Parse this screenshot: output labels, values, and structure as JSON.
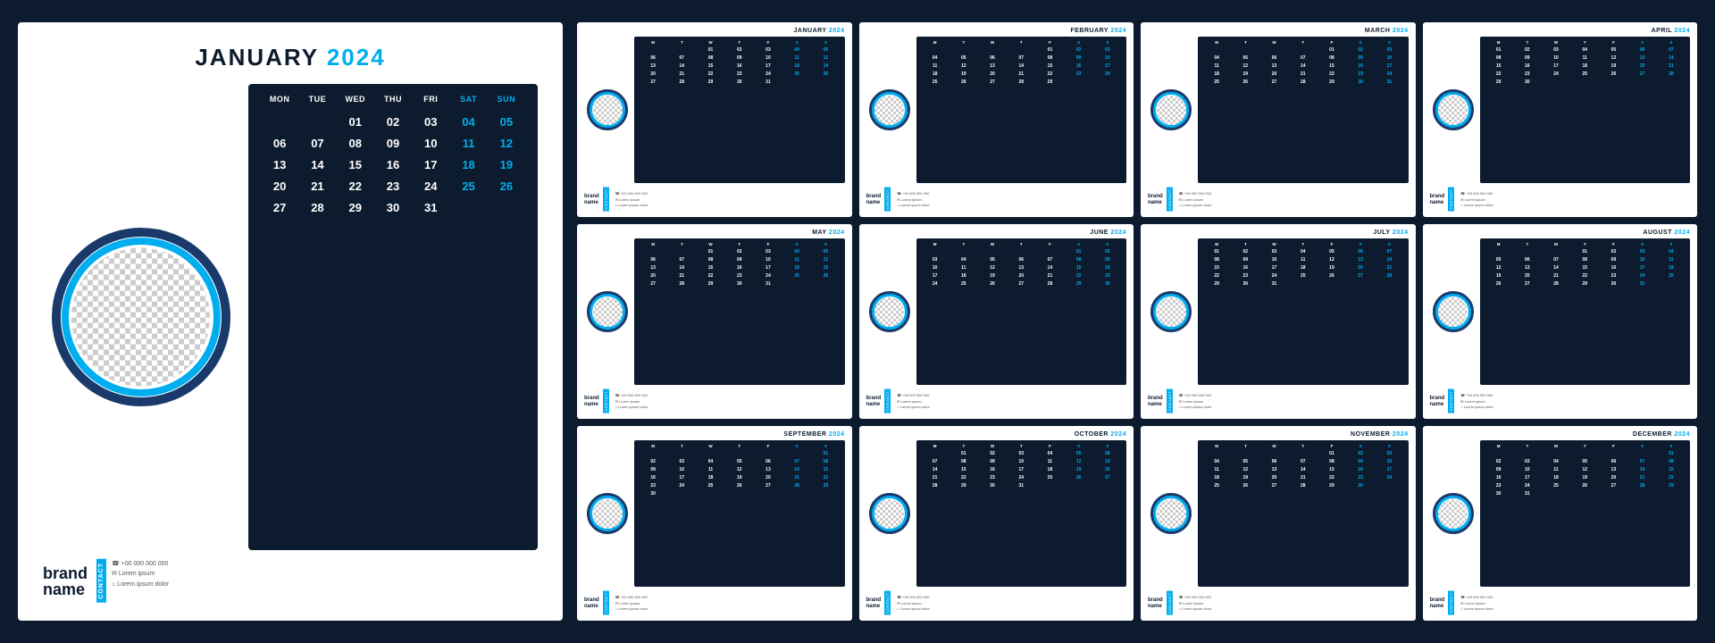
{
  "background_color": "#0d1b2e",
  "accent_color": "#00aeef",
  "dark_color": "#0d1b2e",
  "brand": {
    "name": "brand\nname",
    "contact_label": "CONTACT",
    "phone": "+00 000 000 000",
    "email": "Lorem ipsum",
    "address": "Lorem ipsum dolor"
  },
  "main_calendar": {
    "month": "JANUARY",
    "year": "2024",
    "headers": [
      "MON",
      "TUE",
      "WED",
      "THU",
      "FRI",
      "SAT",
      "SUN"
    ],
    "weekend_indices": [
      5,
      6
    ],
    "days": [
      "",
      "",
      "01",
      "02",
      "03",
      "04",
      "05",
      "06",
      "07",
      "08",
      "09",
      "10",
      "11",
      "12",
      "13",
      "14",
      "15",
      "16",
      "17",
      "18",
      "19",
      "20",
      "21",
      "22",
      "23",
      "24",
      "25",
      "26",
      "27",
      "28",
      "29",
      "30",
      "31",
      "",
      "",
      "",
      ""
    ],
    "weekend_days": [
      "06",
      "07",
      "13",
      "14",
      "20",
      "21",
      "27",
      "28"
    ]
  },
  "small_calendars": [
    {
      "month": "JANUARY",
      "year": "2024",
      "headers": [
        "M",
        "T",
        "W",
        "T",
        "F",
        "S",
        "S"
      ],
      "days": [
        "",
        "",
        "01",
        "02",
        "03",
        "04",
        "05",
        "06",
        "07",
        "08",
        "09",
        "10",
        "11",
        "12",
        "13",
        "14",
        "15",
        "16",
        "17",
        "18",
        "19",
        "20",
        "21",
        "22",
        "23",
        "24",
        "25",
        "26",
        "27",
        "28",
        "29",
        "30",
        "31",
        "",
        "",
        "",
        ""
      ]
    },
    {
      "month": "FEBRUARY",
      "year": "2024",
      "headers": [
        "M",
        "T",
        "W",
        "T",
        "F",
        "S",
        "S"
      ],
      "days": [
        "",
        "",
        "",
        "",
        "01",
        "02",
        "03",
        "04",
        "05",
        "06",
        "07",
        "08",
        "09",
        "10",
        "11",
        "12",
        "13",
        "14",
        "15",
        "16",
        "17",
        "18",
        "19",
        "20",
        "21",
        "22",
        "23",
        "24",
        "25",
        "26",
        "27",
        "28",
        "29",
        "",
        "",
        ""
      ]
    },
    {
      "month": "MARCH",
      "year": "2024",
      "headers": [
        "M",
        "T",
        "W",
        "T",
        "F",
        "S",
        "S"
      ],
      "days": [
        "",
        "",
        "",
        "",
        "01",
        "02",
        "03",
        "04",
        "05",
        "06",
        "07",
        "08",
        "09",
        "10",
        "11",
        "12",
        "13",
        "14",
        "15",
        "16",
        "17",
        "18",
        "19",
        "20",
        "21",
        "22",
        "23",
        "24",
        "25",
        "26",
        "27",
        "28",
        "29",
        "30",
        "31",
        ""
      ]
    },
    {
      "month": "APRIL",
      "year": "2024",
      "headers": [
        "M",
        "T",
        "W",
        "T",
        "F",
        "S",
        "S"
      ],
      "days": [
        "01",
        "02",
        "03",
        "04",
        "05",
        "06",
        "07",
        "08",
        "09",
        "10",
        "11",
        "12",
        "13",
        "14",
        "15",
        "16",
        "17",
        "18",
        "19",
        "20",
        "21",
        "22",
        "23",
        "24",
        "25",
        "26",
        "27",
        "28",
        "29",
        "30",
        "",
        "",
        "",
        "",
        ""
      ]
    },
    {
      "month": "MAY",
      "year": "2024",
      "headers": [
        "M",
        "T",
        "W",
        "T",
        "F",
        "S",
        "S"
      ],
      "days": [
        "",
        "",
        "01",
        "02",
        "03",
        "04",
        "05",
        "06",
        "07",
        "08",
        "09",
        "10",
        "11",
        "12",
        "13",
        "14",
        "15",
        "16",
        "17",
        "18",
        "19",
        "20",
        "21",
        "22",
        "23",
        "24",
        "25",
        "26",
        "27",
        "28",
        "29",
        "30",
        "31",
        "",
        "",
        "",
        ""
      ]
    },
    {
      "month": "JUNE",
      "year": "2024",
      "headers": [
        "M",
        "T",
        "W",
        "T",
        "F",
        "S",
        "S"
      ],
      "days": [
        "",
        "",
        "",
        "",
        "",
        "01",
        "02",
        "03",
        "04",
        "05",
        "06",
        "07",
        "08",
        "09",
        "10",
        "11",
        "12",
        "13",
        "14",
        "15",
        "16",
        "17",
        "18",
        "19",
        "20",
        "21",
        "22",
        "23",
        "24",
        "25",
        "26",
        "27",
        "28",
        "29",
        "30"
      ]
    },
    {
      "month": "JULY",
      "year": "2024",
      "headers": [
        "M",
        "T",
        "W",
        "T",
        "F",
        "S",
        "S"
      ],
      "days": [
        "01",
        "02",
        "03",
        "04",
        "05",
        "06",
        "07",
        "08",
        "09",
        "10",
        "11",
        "12",
        "13",
        "14",
        "15",
        "16",
        "17",
        "18",
        "19",
        "20",
        "21",
        "22",
        "23",
        "24",
        "25",
        "26",
        "27",
        "28",
        "29",
        "30",
        "31",
        "",
        "",
        "",
        ""
      ]
    },
    {
      "month": "AUGUST",
      "year": "2024",
      "headers": [
        "M",
        "T",
        "W",
        "T",
        "F",
        "S",
        "S"
      ],
      "days": [
        "",
        "",
        "",
        "01",
        "02",
        "03",
        "04",
        "05",
        "06",
        "07",
        "08",
        "09",
        "10",
        "11",
        "12",
        "13",
        "14",
        "15",
        "16",
        "17",
        "18",
        "19",
        "20",
        "21",
        "22",
        "23",
        "24",
        "25",
        "26",
        "27",
        "28",
        "29",
        "30",
        "31",
        "",
        ""
      ]
    },
    {
      "month": "SEPTEMBER",
      "year": "2024",
      "headers": [
        "M",
        "T",
        "W",
        "T",
        "F",
        "S",
        "S"
      ],
      "days": [
        "",
        "",
        "",
        "",
        "",
        "",
        "01",
        "02",
        "03",
        "04",
        "05",
        "06",
        "07",
        "08",
        "09",
        "10",
        "11",
        "12",
        "13",
        "14",
        "15",
        "16",
        "17",
        "18",
        "19",
        "20",
        "21",
        "22",
        "23",
        "24",
        "25",
        "26",
        "27",
        "28",
        "29",
        "30"
      ]
    },
    {
      "month": "OCTOBER",
      "year": "2024",
      "headers": [
        "M",
        "T",
        "W",
        "T",
        "F",
        "S",
        "S"
      ],
      "days": [
        "",
        "01",
        "02",
        "03",
        "04",
        "05",
        "06",
        "07",
        "08",
        "09",
        "10",
        "11",
        "12",
        "13",
        "14",
        "15",
        "16",
        "17",
        "18",
        "19",
        "20",
        "21",
        "22",
        "23",
        "24",
        "25",
        "26",
        "27",
        "28",
        "29",
        "30",
        "31",
        "",
        "",
        "",
        ""
      ]
    },
    {
      "month": "NOVEMBER",
      "year": "2024",
      "headers": [
        "M",
        "T",
        "W",
        "T",
        "F",
        "S",
        "S"
      ],
      "days": [
        "",
        "",
        "",
        "",
        "01",
        "02",
        "03",
        "04",
        "05",
        "06",
        "07",
        "08",
        "09",
        "10",
        "11",
        "12",
        "13",
        "14",
        "15",
        "16",
        "17",
        "18",
        "19",
        "20",
        "21",
        "22",
        "23",
        "24",
        "25",
        "26",
        "27",
        "28",
        "29",
        "30",
        "",
        ""
      ]
    },
    {
      "month": "DECEMBER",
      "year": "2024",
      "headers": [
        "M",
        "T",
        "W",
        "T",
        "F",
        "S",
        "S"
      ],
      "days": [
        "",
        "",
        "",
        "",
        "",
        "",
        "01",
        "02",
        "03",
        "04",
        "05",
        "06",
        "07",
        "08",
        "09",
        "10",
        "11",
        "12",
        "13",
        "14",
        "15",
        "16",
        "17",
        "18",
        "19",
        "20",
        "21",
        "22",
        "23",
        "24",
        "25",
        "26",
        "27",
        "28",
        "29",
        "30",
        "31"
      ]
    }
  ]
}
